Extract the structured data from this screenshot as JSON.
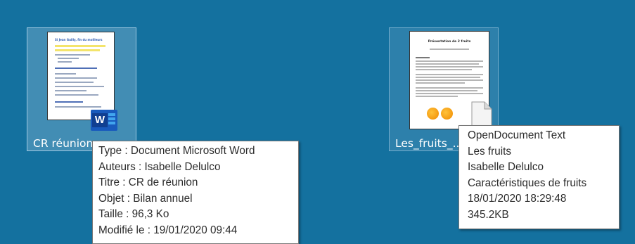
{
  "desktop": {
    "background_color": "#14719f",
    "icons": [
      {
        "label": "CR réunion ...",
        "file_type_icon": "word-icon",
        "selected": true
      },
      {
        "label": "Les_fruits_...",
        "file_type_icon": "generic-file-icon",
        "selected": false
      }
    ]
  },
  "tooltip_word": {
    "type": "Type : Document Microsoft Word",
    "authors": "Auteurs : Isabelle Delulco",
    "title": "Titre : CR de réunion",
    "subject": "Objet : Bilan annuel",
    "size": "Taille : 96,3 Ko",
    "modified": "Modifié le : 19/01/2020 09:44"
  },
  "tooltip_odt": {
    "type": "OpenDocument Text",
    "title": "Les fruits",
    "author": "Isabelle Delulco",
    "subject": "Caractéristiques de fruits",
    "date": "18/01/2020 18:29:48",
    "size": "345.2KB"
  }
}
